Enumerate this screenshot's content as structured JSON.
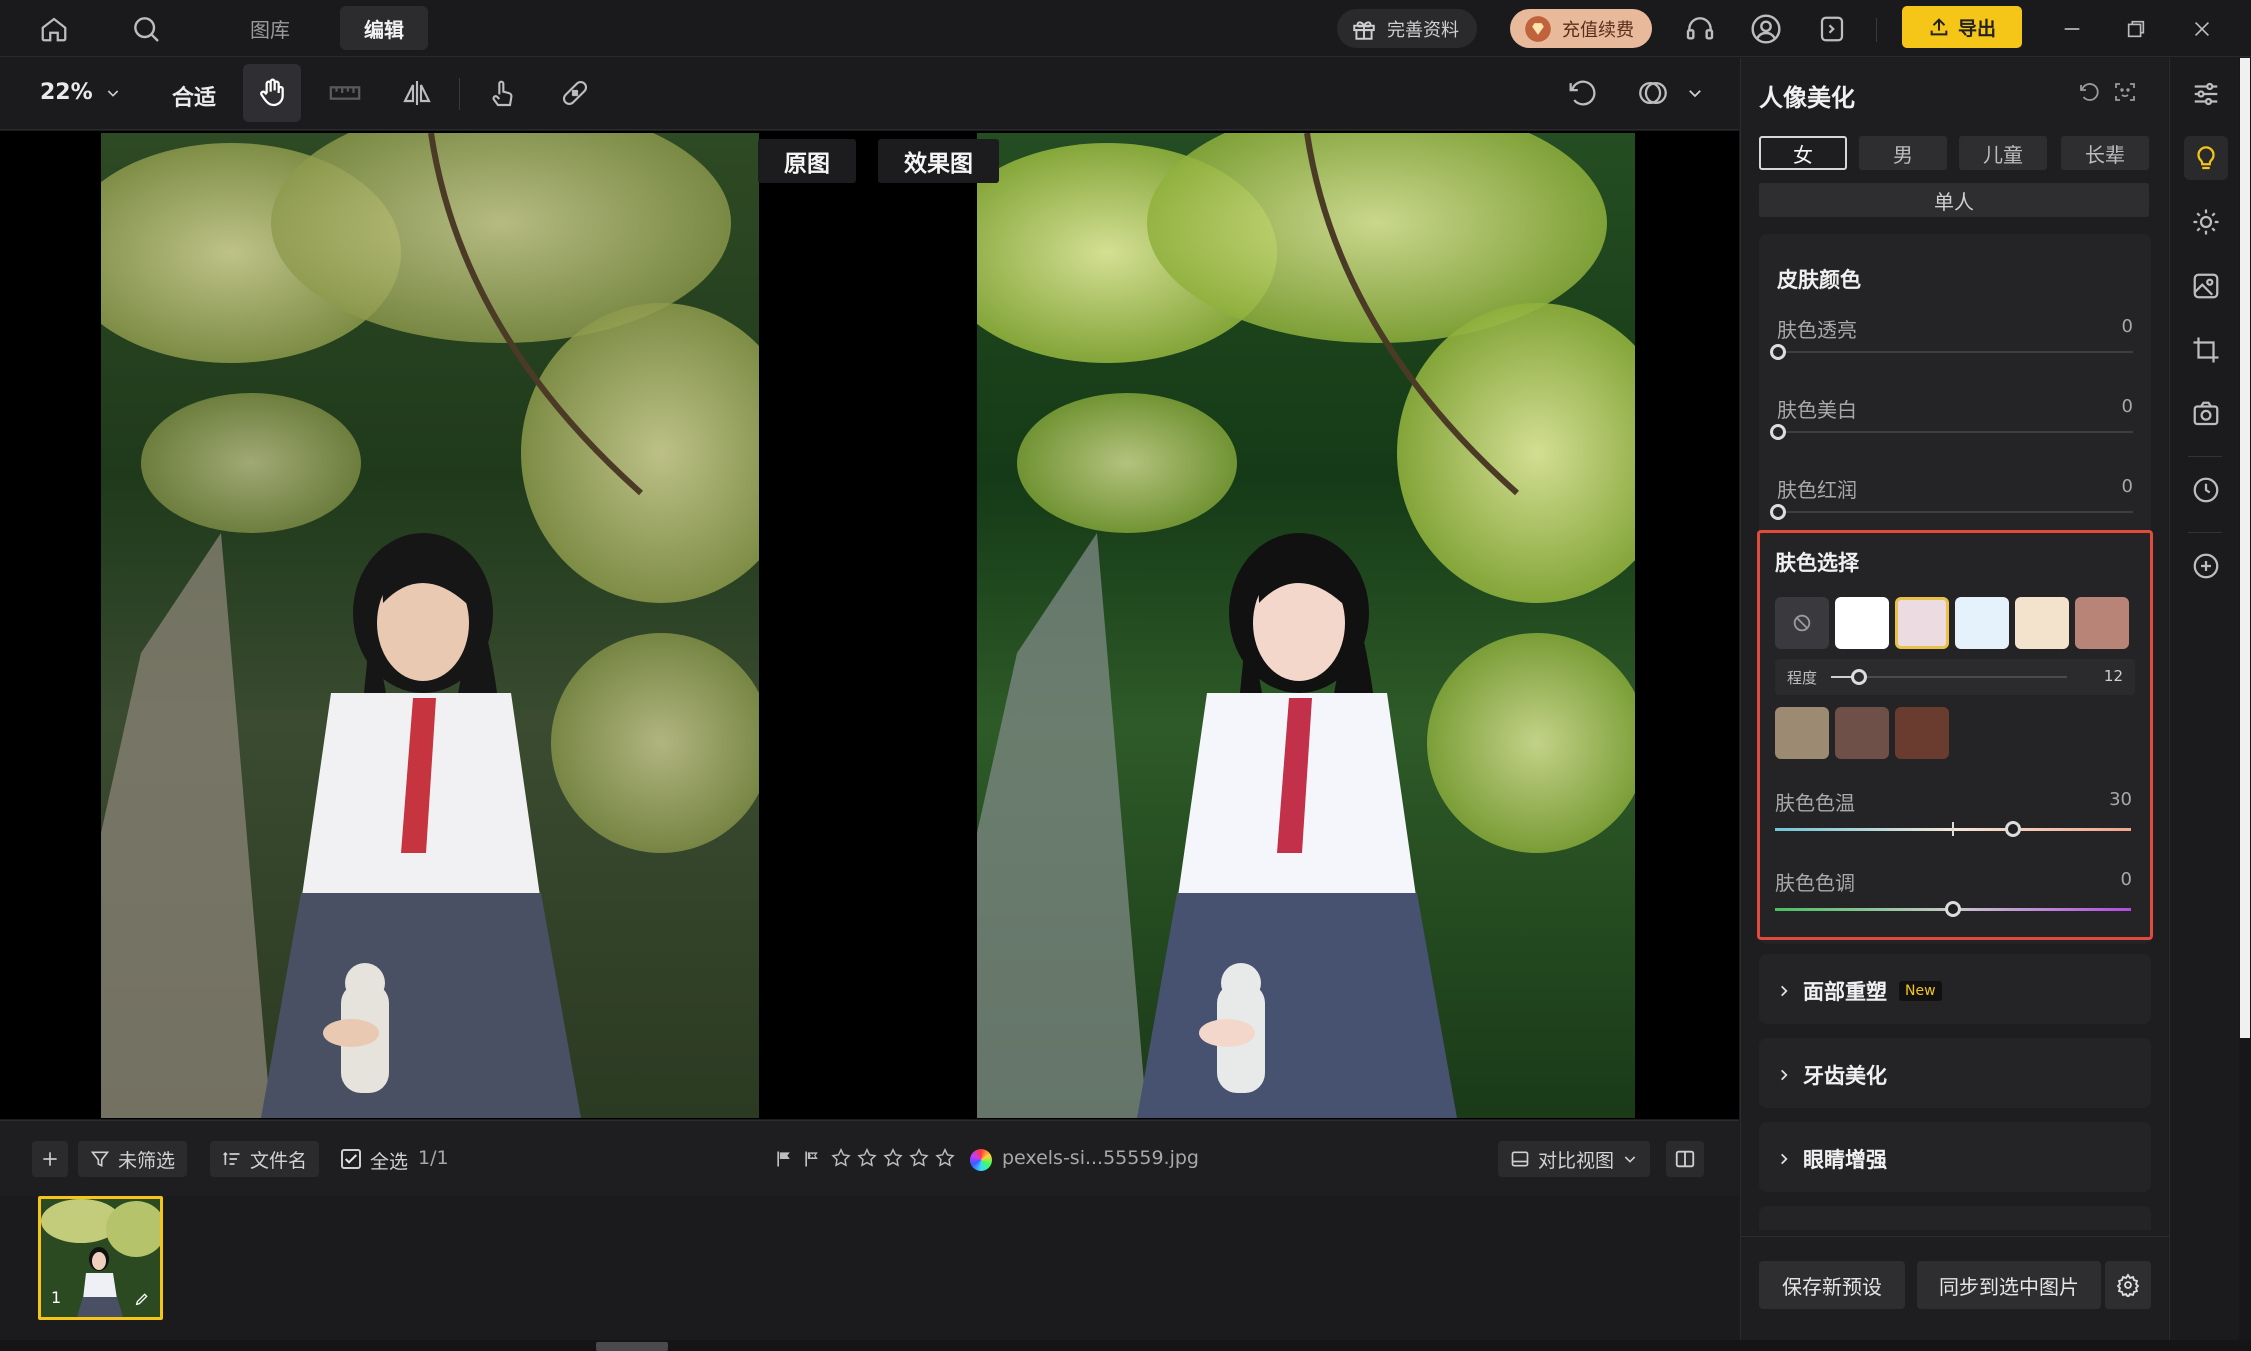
{
  "topbar": {
    "tabs": [
      {
        "label": "图库"
      },
      {
        "label": "编辑"
      }
    ],
    "gift_label": "完善资料",
    "recharge_label": "充值续费",
    "export_label": "导出"
  },
  "toolbar": {
    "zoom": "22%",
    "fit": "合适"
  },
  "compare": {
    "original_label": "原图",
    "effect_label": "效果图"
  },
  "strip": {
    "filter_label": "未筛选",
    "sort_label": "文件名",
    "select_all_label": "全选",
    "count": "1/1",
    "filename": "pexels-si...55559.jpg",
    "view_label": "对比视图",
    "thumb_index": "1",
    "rating_stars": 0
  },
  "panel": {
    "title": "人像美化",
    "genders": [
      "女",
      "男",
      "儿童",
      "长辈"
    ],
    "single_label": "单人",
    "skin": {
      "title": "皮肤颜色",
      "sliders": [
        {
          "label": "肤色透亮",
          "value": "0"
        },
        {
          "label": "肤色美白",
          "value": "0"
        },
        {
          "label": "肤色红润",
          "value": "0"
        }
      ]
    },
    "skin_select": {
      "title": "肤色选择",
      "degree_label": "程度",
      "degree_value": "12",
      "temp_label": "肤色色温",
      "temp_value": "30",
      "tone_label": "肤色色调",
      "tone_value": "0",
      "swatches_row1": [
        "#ffffff",
        "#ecdbe0",
        "#e6f2fb",
        "#f3e3cc",
        "#b88478"
      ],
      "swatches_row2": [
        "#9c8a72",
        "#6e5049",
        "#6a3b2f"
      ]
    },
    "collapsed": [
      {
        "label": "面部重塑",
        "badge": "New"
      },
      {
        "label": "牙齿美化",
        "badge": ""
      },
      {
        "label": "眼睛增强",
        "badge": ""
      }
    ],
    "save_preset": "保存新预设",
    "sync_label": "同步到选中图片"
  },
  "colors": {
    "accent": "#f5c518",
    "highlight_border": "#e24a3b"
  }
}
